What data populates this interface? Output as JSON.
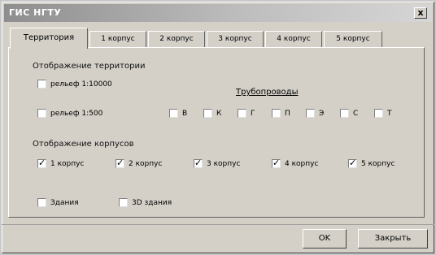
{
  "window": {
    "title": "ГИС НГТУ",
    "close_label": "x"
  },
  "tabs": [
    {
      "label": "Территория"
    },
    {
      "label": "1 корпус"
    },
    {
      "label": "2 корпус"
    },
    {
      "label": "3 корпус"
    },
    {
      "label": "4 корпус"
    },
    {
      "label": "5 корпус"
    }
  ],
  "territory": {
    "group_label": "Отображение территории",
    "relief_10000": "рельеф 1:10000",
    "relief_500": "рельеф 1:500"
  },
  "pipes": {
    "title": "Трубопроводы",
    "items": [
      "В",
      "К",
      "Г",
      "П",
      "Э",
      "С",
      "Т"
    ]
  },
  "buildings": {
    "group_label": "Отображение корпусов",
    "items": [
      {
        "label": "1 корпус",
        "checked": true
      },
      {
        "label": "2 корпус",
        "checked": true
      },
      {
        "label": "3 корпус",
        "checked": true
      },
      {
        "label": "4 корпус",
        "checked": true
      },
      {
        "label": "5 корпус",
        "checked": true
      }
    ],
    "extras": [
      {
        "label": "Здания",
        "checked": false
      },
      {
        "label": "3D здания",
        "checked": false
      }
    ]
  },
  "footer": {
    "ok": "OK",
    "close": "Закрыть"
  }
}
